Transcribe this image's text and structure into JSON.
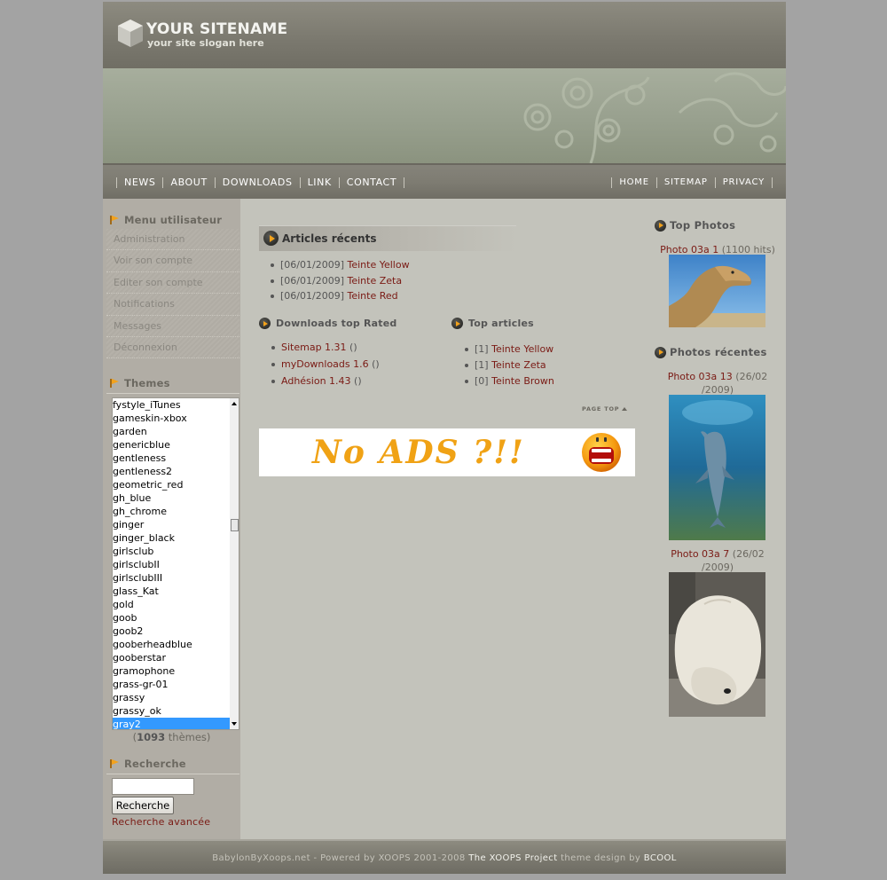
{
  "header": {
    "site_name": "YOUR SITENAME",
    "slogan": "your site slogan here"
  },
  "nav": {
    "left": [
      "NEWS",
      "ABOUT",
      "DOWNLOADS",
      "LINK",
      "CONTACT"
    ],
    "right": [
      "HOME",
      "SITEMAP",
      "PRIVACY"
    ]
  },
  "user_menu": {
    "title": "Menu utilisateur",
    "items": [
      "Administration",
      "Voir son compte",
      "Editer son compte",
      "Notifications",
      "Messages",
      "Déconnexion"
    ]
  },
  "themes": {
    "title": "Themes",
    "options": [
      "fystyle_iTunes",
      "gameskin-xbox",
      "garden",
      "genericblue",
      "gentleness",
      "gentleness2",
      "geometric_red",
      "gh_blue",
      "gh_chrome",
      "ginger",
      "ginger_black",
      "girlsclub",
      "girlsclubII",
      "girlsclubIII",
      "glass_Kat",
      "gold",
      "goob",
      "goob2",
      "gooberheadblue",
      "gooberstar",
      "gramophone",
      "grass-gr-01",
      "grassy",
      "grassy_ok",
      "gray2"
    ],
    "selected": "gray2",
    "count_open": "(",
    "count": "1093",
    "count_suffix": " thèmes)"
  },
  "search": {
    "title": "Recherche",
    "value": "",
    "button_label": "Recherche",
    "advanced_label": "Recherche avancée"
  },
  "recent_articles": {
    "title": "Articles récents",
    "items": [
      {
        "date": "[06/01/2009]",
        "title": "Teinte Yellow"
      },
      {
        "date": "[06/01/2009]",
        "title": "Teinte Zeta"
      },
      {
        "date": "[06/01/2009]",
        "title": "Teinte Red"
      }
    ]
  },
  "downloads_top": {
    "title": "Downloads top Rated",
    "items": [
      {
        "title": "Sitemap 1.31",
        "extra": "()"
      },
      {
        "title": "myDownloads 1.6",
        "extra": "()"
      },
      {
        "title": "Adhésion 1.43",
        "extra": "()"
      }
    ]
  },
  "top_articles": {
    "title": "Top articles",
    "items": [
      {
        "count": "[1]",
        "title": "Teinte Yellow"
      },
      {
        "count": "[1]",
        "title": "Teinte Zeta"
      },
      {
        "count": "[0]",
        "title": "Teinte Brown"
      }
    ]
  },
  "page_top_label": "PAGE TOP",
  "ad": {
    "text": "No ADS ?!!"
  },
  "top_photos": {
    "title": "Top Photos",
    "photo": {
      "title": "Photo 03a 1",
      "meta": "(1100 hits)"
    }
  },
  "recent_photos": {
    "title": "Photos récentes",
    "photos": [
      {
        "title": "Photo 03a 13",
        "meta_line1": "(26/02",
        "meta_line2": "/2009)"
      },
      {
        "title": "Photo 03a 7",
        "meta_line1": "(26/02",
        "meta_line2": "/2009)"
      }
    ]
  },
  "footer": {
    "part1": "BabylonByXoops.net - Powered by XOOPS 2001-2008 ",
    "link1": "The XOOPS Project",
    "part2": " theme design by ",
    "link2": "BCOOL"
  },
  "colors": {
    "link": "#7a1a14",
    "accent_orange": "#f3a21c",
    "page_bg": "#c3c3bb",
    "outer_bg": "#a3a3a3",
    "selected_option": "#3399ff"
  }
}
